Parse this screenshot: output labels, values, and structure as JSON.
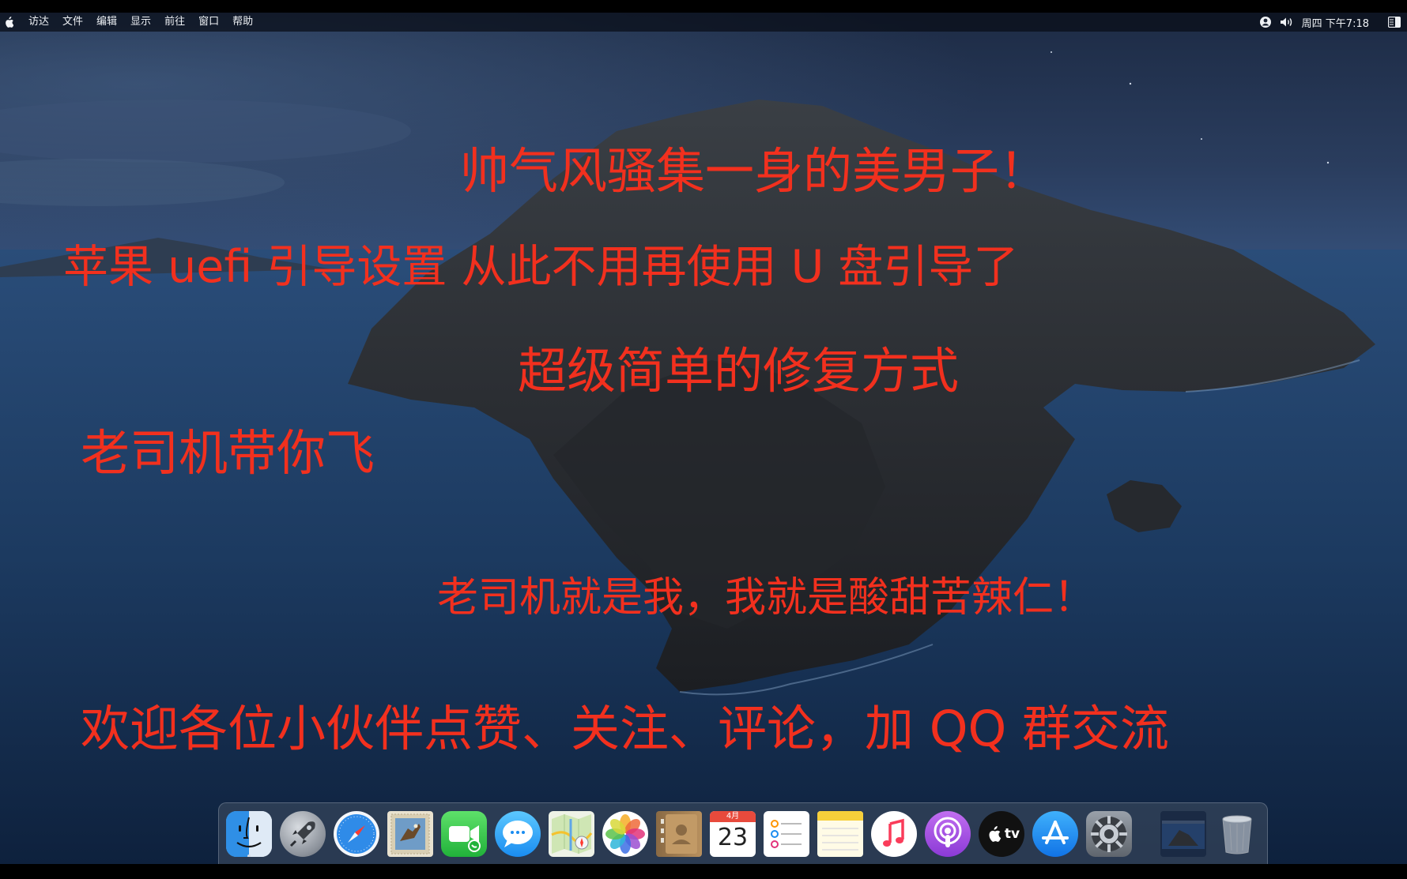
{
  "menubar": {
    "apple_icon": "apple-logo",
    "items": [
      "访达",
      "文件",
      "编辑",
      "显示",
      "前往",
      "窗口",
      "帮助"
    ],
    "status_icons": [
      "user-switch-icon",
      "volume-icon"
    ],
    "clock": "周四 下午7:18",
    "control_icon": "notification-center-icon"
  },
  "captions": {
    "line1": "帅气风骚集一身的美男子！",
    "line2": "苹果 uefi 引导设置 从此不用再使用 U 盘引导了",
    "line3": "超级简单的修复方式",
    "line4": "老司机带你飞",
    "line5": "老司机就是我，我就是酸甜苦辣仁！",
    "line6": "欢迎各位小伙伴点赞、关注、评论，加 QQ 群交流"
  },
  "colors": {
    "caption": "#f2301e",
    "menubar_text": "#eef1f5"
  },
  "dock": {
    "apps": [
      {
        "name": "finder",
        "icon": "finder-icon"
      },
      {
        "name": "launchpad",
        "icon": "rocket-icon"
      },
      {
        "name": "safari",
        "icon": "compass-icon"
      },
      {
        "name": "mail",
        "icon": "eagle-stamp-icon"
      },
      {
        "name": "facetime",
        "icon": "video-camera-icon"
      },
      {
        "name": "messages",
        "icon": "speech-bubble-icon"
      },
      {
        "name": "maps",
        "icon": "map-icon"
      },
      {
        "name": "photos",
        "icon": "flower-icon"
      },
      {
        "name": "contacts",
        "icon": "address-book-icon"
      },
      {
        "name": "calendar",
        "icon": "calendar-icon",
        "month": "4月",
        "day": "23"
      },
      {
        "name": "reminders",
        "icon": "checklist-icon"
      },
      {
        "name": "notes",
        "icon": "notepad-icon"
      },
      {
        "name": "music",
        "icon": "music-note-icon"
      },
      {
        "name": "podcasts",
        "icon": "podcast-icon"
      },
      {
        "name": "apple-tv",
        "icon": "tv-icon",
        "label": "tv"
      },
      {
        "name": "app-store",
        "icon": "app-store-icon"
      },
      {
        "name": "system-preferences",
        "icon": "gear-icon"
      }
    ],
    "extras": [
      {
        "name": "desktop-thumbnail",
        "icon": "window-thumbnail-icon"
      },
      {
        "name": "trash",
        "icon": "trash-icon"
      }
    ]
  }
}
